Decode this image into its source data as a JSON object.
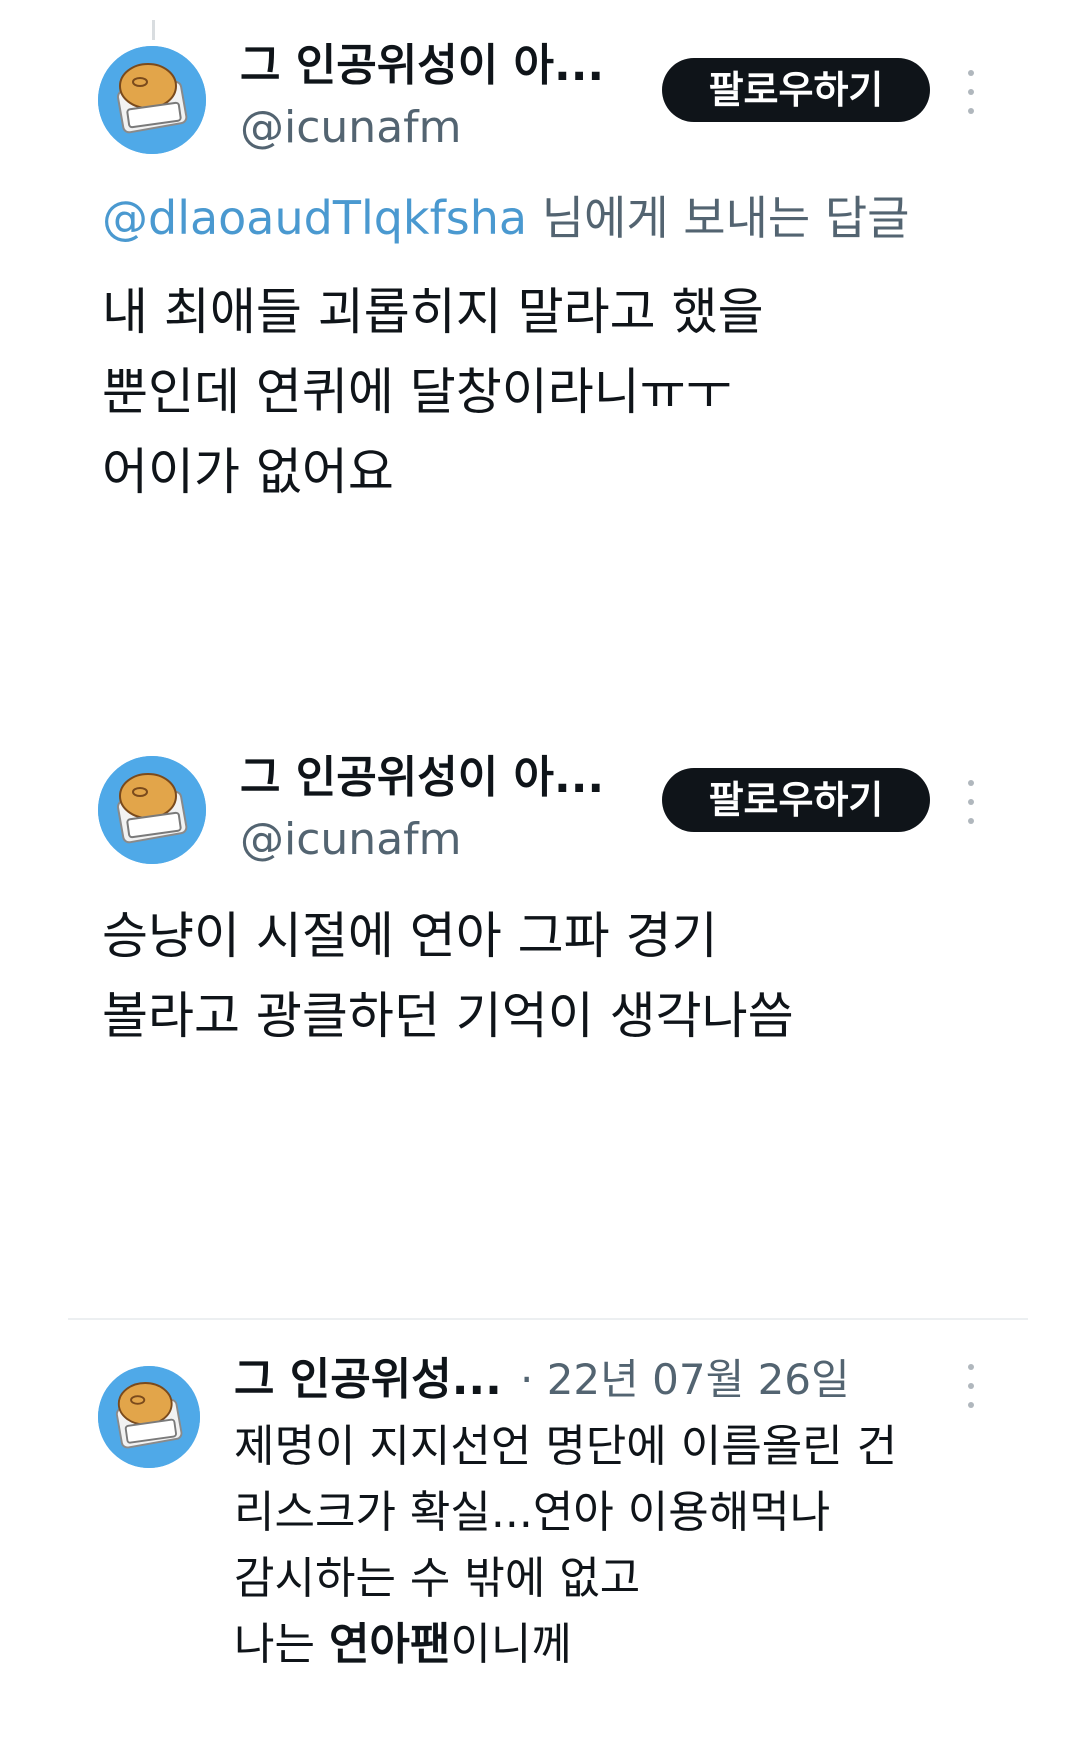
{
  "tweets": [
    {
      "display_name": "그 인공위성이 아...",
      "handle": "@icunafm",
      "follow_label": "팔로우하기",
      "reply_to_handle": "@dlaoaudTlqkfsha",
      "reply_suffix": " 님에게 보내는 답글",
      "lines": [
        "내 최애들 괴롭히지 말라고 했을",
        "뿐인데 연퀴에 달창이라니ㅠㅜ",
        "어이가 없어요"
      ]
    },
    {
      "display_name": "그 인공위성이 아...",
      "handle": "@icunafm",
      "follow_label": "팔로우하기",
      "lines": [
        "승냥이 시절에 연아 그파 경기",
        "볼라고 광클하던 기억이 생각나씀"
      ]
    },
    {
      "display_name": "그 인공위성...",
      "date": "· 22년 07월 26일",
      "lines": [
        "제명이 지지선언 명단에 이름올린 건",
        "리스크가 확실...연아 이용해먹나",
        "감시하는 수 밖에 없고"
      ],
      "last_line_prefix": "나는 ",
      "last_line_bold": "연아팬",
      "last_line_suffix": "이니께"
    }
  ],
  "icons": {
    "avatar": "sandwich-avatar-icon",
    "more": "more-vertical-icon"
  },
  "colors": {
    "mention": "#4a99d0",
    "follow_bg": "#0f1419",
    "muted": "#536471"
  }
}
